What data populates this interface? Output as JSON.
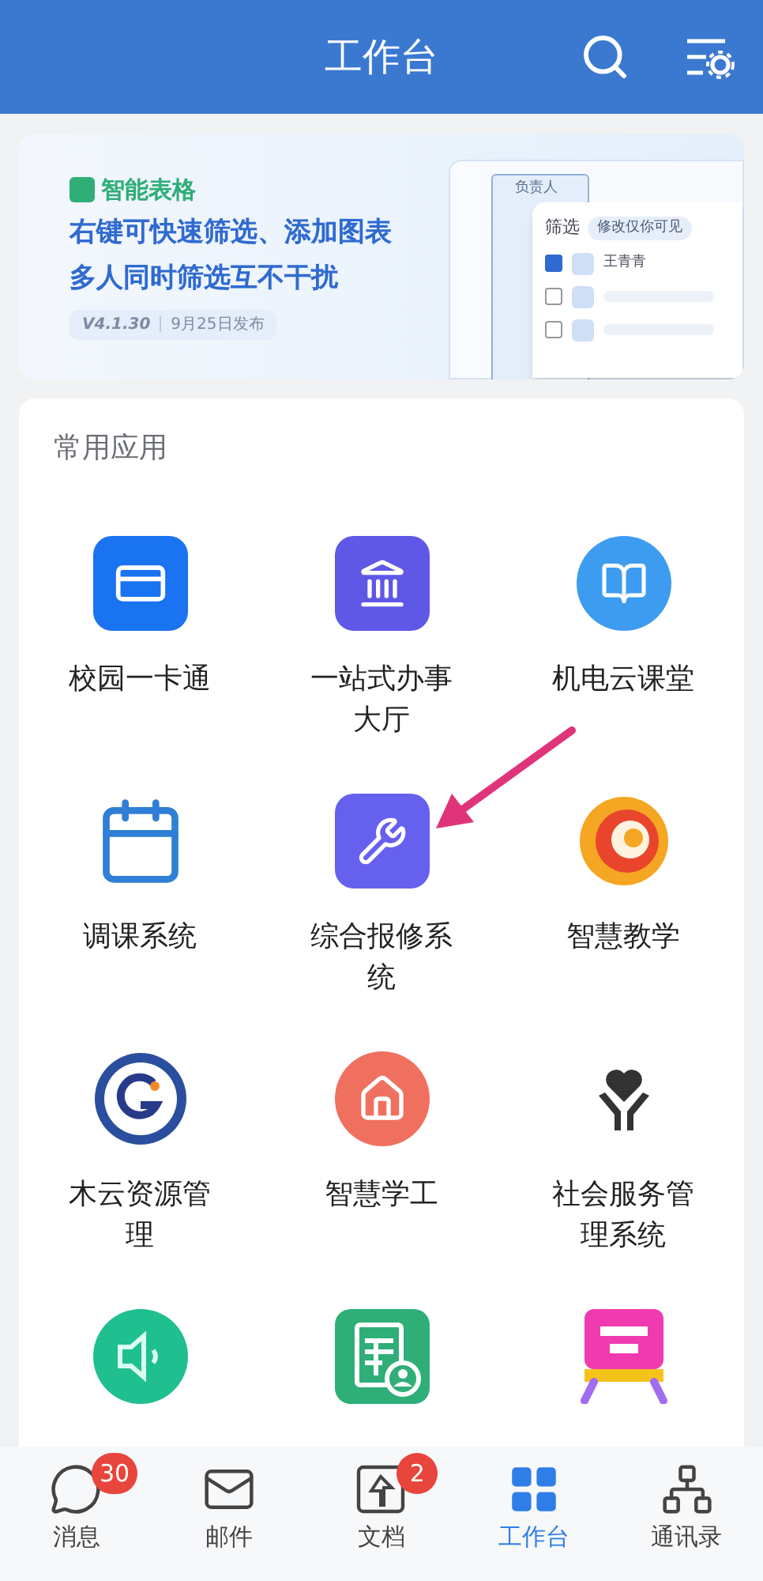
{
  "header": {
    "title": "工作台"
  },
  "banner": {
    "tag": "智能表格",
    "headline": [
      "右键可快速筛选、添加图表",
      "多人同时筛选互不干扰"
    ],
    "version": "V4.1.30",
    "release": "9月25日发布",
    "preview": {
      "column": "负责人",
      "filter": "筛选",
      "scope": "修改仅你可见",
      "rows": [
        {
          "name": "王青青",
          "checked": true
        },
        {
          "checked": false
        },
        {
          "checked": false
        }
      ]
    }
  },
  "section": {
    "title": "常用应用"
  },
  "apps": [
    {
      "label": "校园一卡通",
      "kind": "card"
    },
    {
      "label": "一站式办事大厅",
      "kind": "hall"
    },
    {
      "label": "机电云课堂",
      "kind": "book"
    },
    {
      "label": "调课系统",
      "kind": "calendar"
    },
    {
      "label": "综合报修系统",
      "kind": "wrench"
    },
    {
      "label": "智慧教学",
      "kind": "swirl"
    },
    {
      "label": "木云资源管理",
      "kind": "emblem"
    },
    {
      "label": "智慧学工",
      "kind": "house"
    },
    {
      "label": "社会服务管理系统",
      "kind": "hands"
    },
    {
      "kind": "speaker"
    },
    {
      "kind": "sheet"
    },
    {
      "kind": "stand"
    }
  ],
  "tabs": [
    {
      "label": "消息",
      "kind": "chat",
      "badge": "30",
      "selected": false
    },
    {
      "label": "邮件",
      "kind": "mail",
      "selected": false
    },
    {
      "label": "文档",
      "kind": "doc",
      "badge": "2",
      "selected": false
    },
    {
      "label": "工作台",
      "kind": "grid",
      "selected": true
    },
    {
      "label": "通讯录",
      "kind": "org",
      "selected": false
    }
  ]
}
